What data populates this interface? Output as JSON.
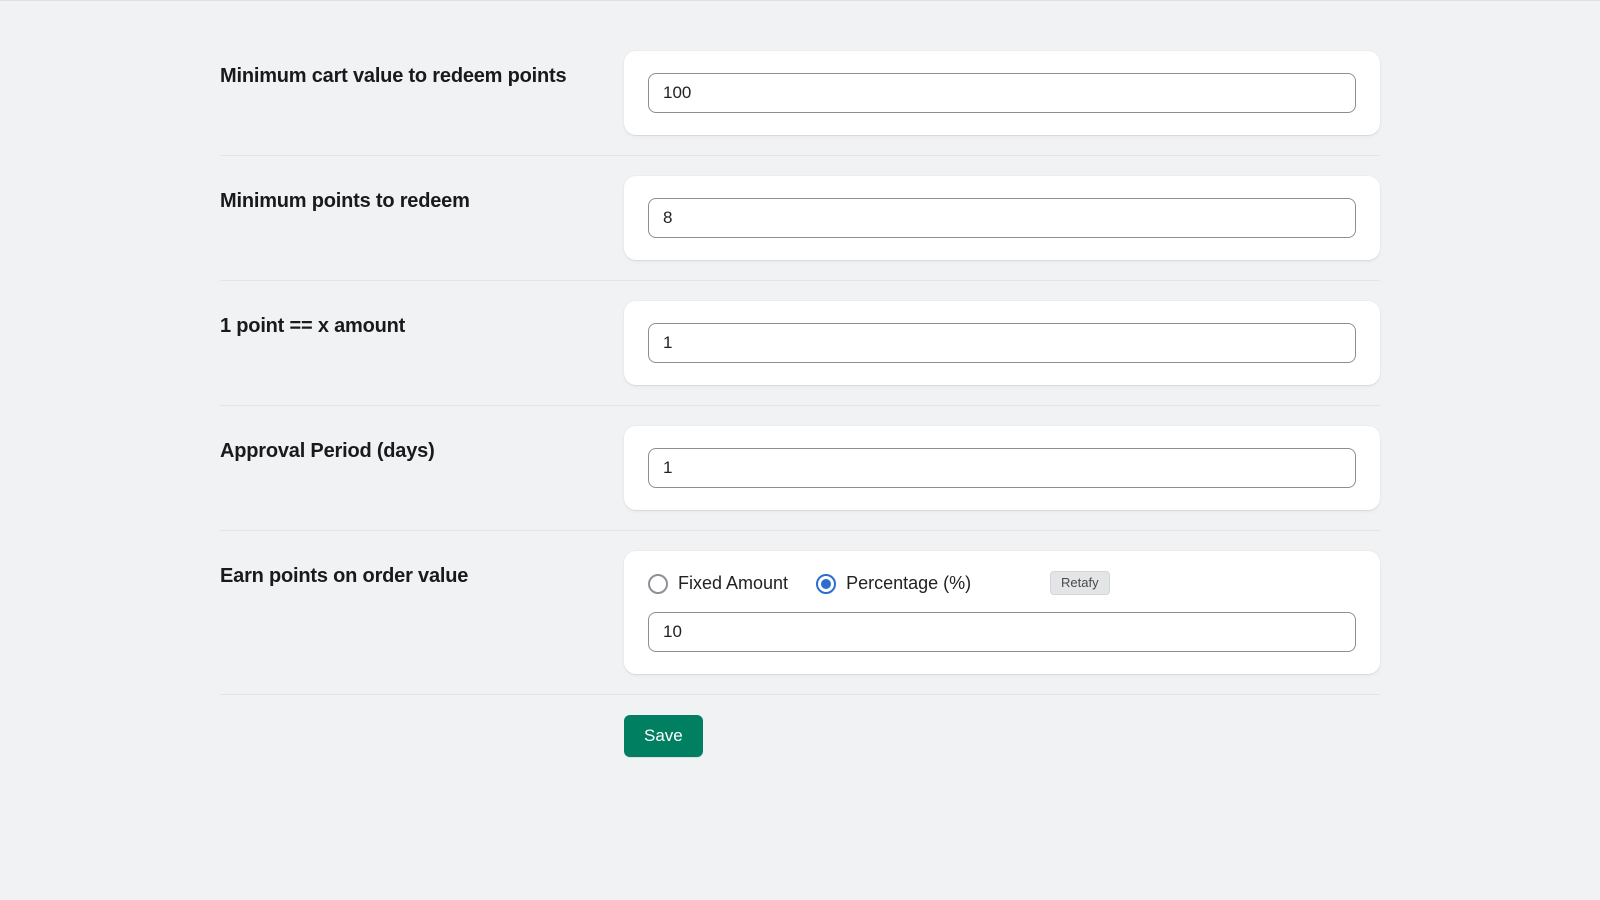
{
  "settings": {
    "min_cart_value": {
      "label": "Minimum cart value to redeem points",
      "value": "100"
    },
    "min_points": {
      "label": "Minimum points to redeem",
      "value": "8"
    },
    "point_amount": {
      "label": "1 point == x amount",
      "value": "1"
    },
    "approval_period": {
      "label": "Approval Period (days)",
      "value": "1"
    },
    "earn_points": {
      "label": "Earn points on order value",
      "options": {
        "fixed": "Fixed Amount",
        "percentage": "Percentage (%)"
      },
      "selected": "percentage",
      "value": "10",
      "tag": "Retafy"
    }
  },
  "actions": {
    "save": "Save"
  }
}
